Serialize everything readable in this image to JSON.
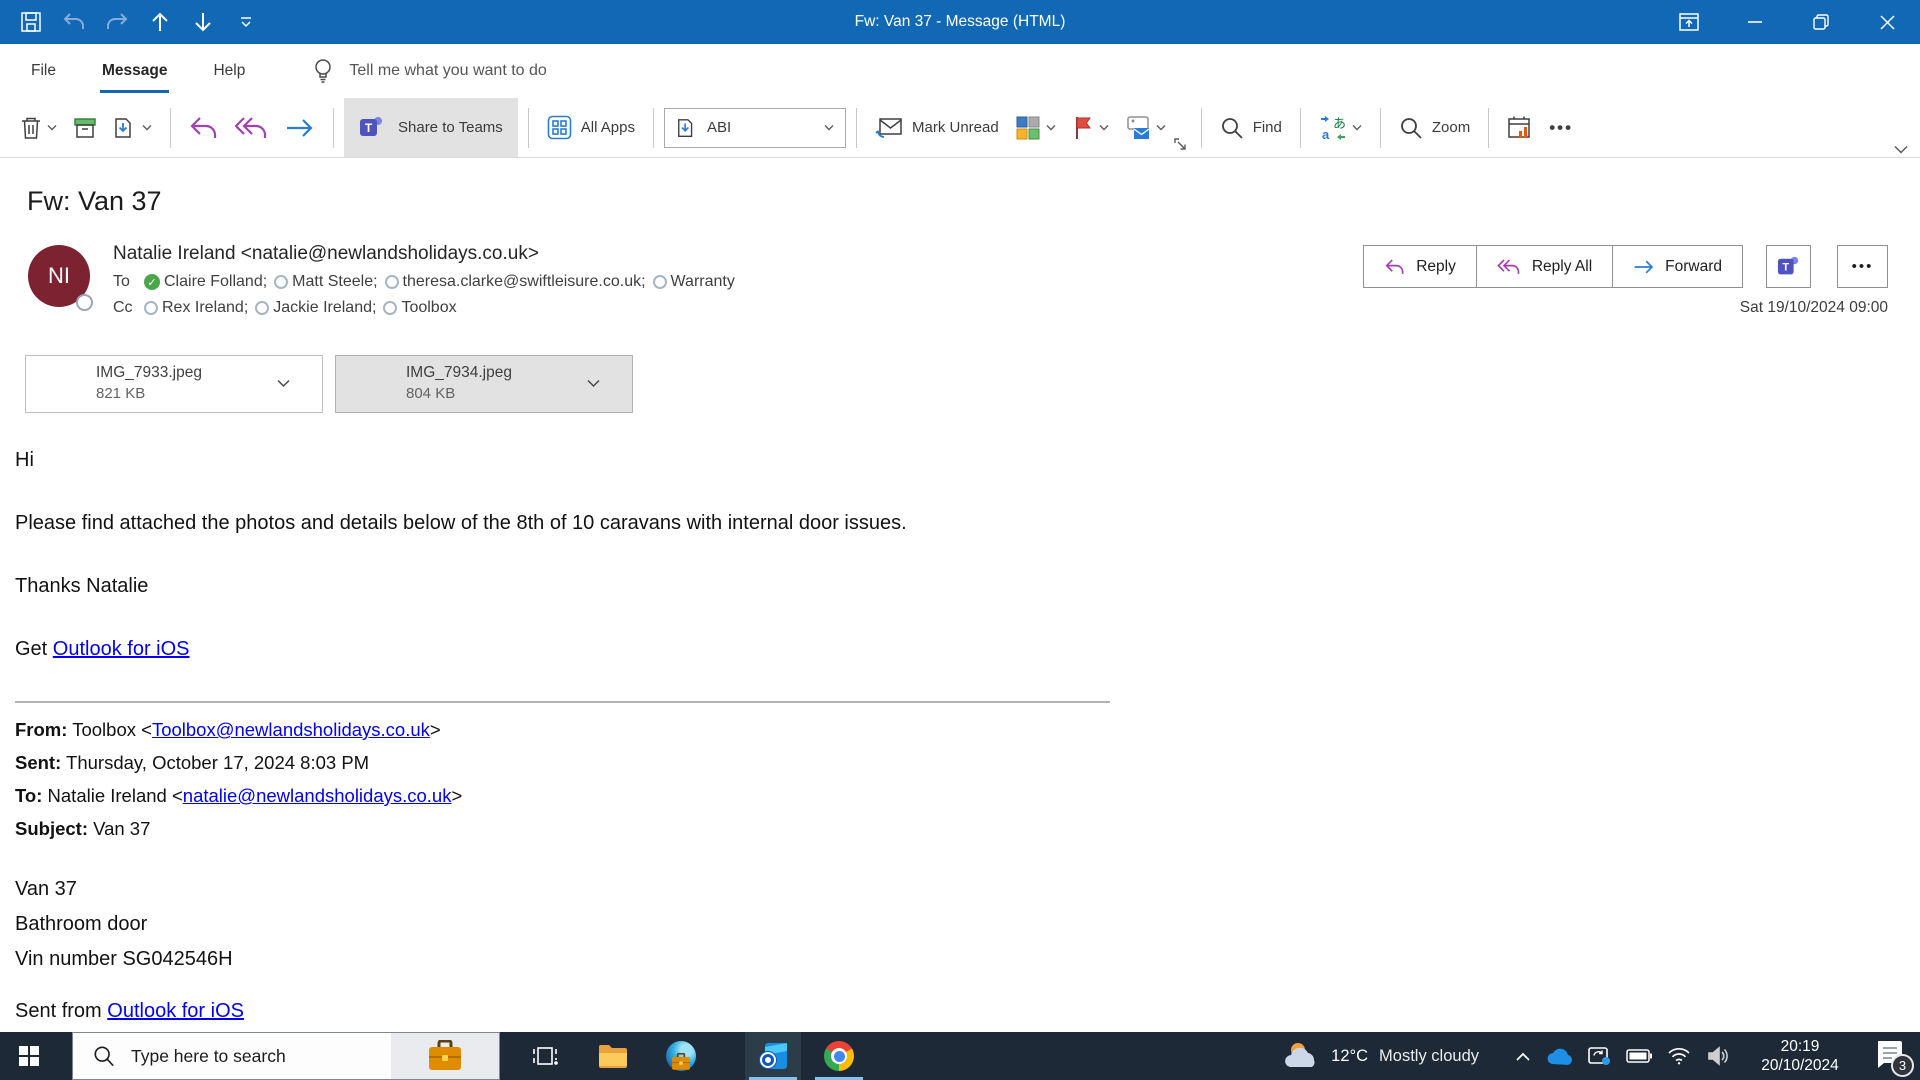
{
  "titlebar": {
    "title": "Fw: Van 37 - Message (HTML)"
  },
  "ribbon": {
    "tabs": [
      {
        "label": "File"
      },
      {
        "label": "Message"
      },
      {
        "label": "Help"
      }
    ],
    "tellme": "Tell me what you want to do",
    "share_to_teams": "Share to Teams",
    "all_apps": "All Apps",
    "quick_step": "ABI",
    "mark_unread": "Mark Unread",
    "find": "Find",
    "zoom": "Zoom"
  },
  "message": {
    "subject": "Fw: Van 37",
    "sender": {
      "initials": "NI",
      "from_line": "Natalie Ireland <natalie@newlandsholidays.co.uk>"
    },
    "to_label": "To",
    "cc_label": "Cc",
    "to": [
      {
        "name": "Claire Folland;"
      },
      {
        "name": "Matt Steele;"
      },
      {
        "name": "theresa.clarke@swiftleisure.co.uk;"
      },
      {
        "name": "Warranty"
      }
    ],
    "cc": [
      {
        "name": "Rex Ireland;"
      },
      {
        "name": "Jackie Ireland;"
      },
      {
        "name": "Toolbox"
      }
    ],
    "actions": {
      "reply": "Reply",
      "reply_all": "Reply All",
      "forward": "Forward",
      "more": "•••"
    },
    "date": "Sat 19/10/2024 09:00",
    "attachments": [
      {
        "name": "IMG_7933.jpeg",
        "size": "821 KB"
      },
      {
        "name": "IMG_7934.jpeg",
        "size": "804 KB"
      }
    ],
    "body": {
      "greeting": "Hi",
      "para": "Please find attached the photos and details below of the 8th of 10 caravans with internal door issues.",
      "thanks": "Thanks Natalie",
      "get_prefix": "Get ",
      "get_link": "Outlook for iOS",
      "quoted": [
        {
          "label": "From:",
          "pre": " Toolbox <",
          "link": "Toolbox@newlandsholidays.co.uk",
          "post": ">"
        },
        {
          "label": "Sent:",
          "pre": " Thursday, October 17, 2024 8:03 PM"
        },
        {
          "label": "To:",
          "pre": " Natalie Ireland <",
          "link": "natalie@newlandsholidays.co.uk",
          "post": ">"
        },
        {
          "label": "Subject:",
          "pre": " Van 37"
        }
      ],
      "details": [
        "Van 37",
        "Bathroom door",
        "Vin number SG042546H"
      ],
      "sent_from_prefix": "Sent from ",
      "sent_from_link": "Outlook for iOS"
    }
  },
  "taskbar": {
    "search_placeholder": "Type here to search",
    "weather": {
      "temp": "12°C",
      "condition": "Mostly cloudy"
    },
    "clock": {
      "time": "20:19",
      "date": "20/10/2024"
    },
    "notification_count": "3"
  },
  "colors": {
    "titlebar_blue": "#1169b5",
    "accent_blue": "#1267b5",
    "link_blue": "#0000ee",
    "avatar_maroon": "#7c2230",
    "accepted_green": "#4aa64a",
    "flag_red": "#e04a3f",
    "taskbar_dark": "#1d2936"
  }
}
